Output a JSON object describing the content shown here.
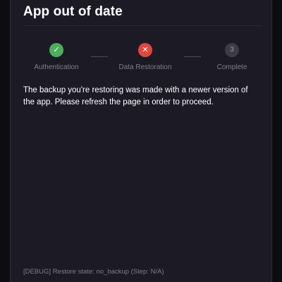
{
  "dialog": {
    "title": "App out of date",
    "steps": [
      {
        "label": "Authentication",
        "status": "success",
        "icon": "check-icon",
        "glyph": "✓"
      },
      {
        "label": "Data Restoration",
        "status": "error",
        "icon": "x-icon",
        "glyph": "✕"
      },
      {
        "label": "Complete",
        "status": "pending",
        "icon": "step-number-3",
        "glyph": "3"
      }
    ],
    "message": "The backup you're restoring was made with a newer version of the app. Please refresh the page in order to proceed.",
    "debug": "[DEBUG] Restore state: no_backup (Step: N/A)"
  },
  "colors": {
    "background": "#1c1b25",
    "success": "#4caf5a",
    "error": "#e2473f",
    "pending": "#3d3c46"
  }
}
